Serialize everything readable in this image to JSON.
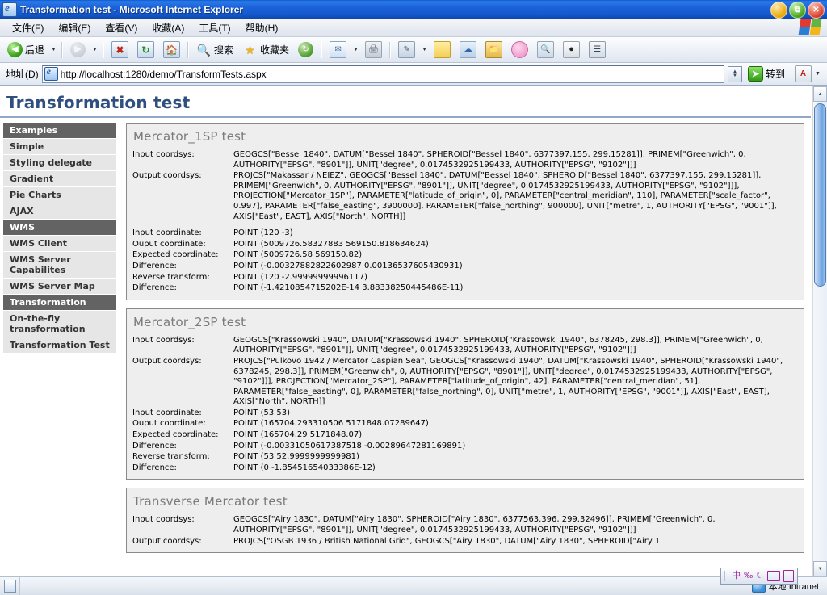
{
  "window": {
    "title": "Transformation test - Microsoft Internet Explorer",
    "minimize_label": "–",
    "restore_label": "❐",
    "close_label": "✕"
  },
  "menu": [
    {
      "label": "文件(F)",
      "name": "menu-file"
    },
    {
      "label": "编辑(E)",
      "name": "menu-edit"
    },
    {
      "label": "查看(V)",
      "name": "menu-view"
    },
    {
      "label": "收藏(A)",
      "name": "menu-favorites"
    },
    {
      "label": "工具(T)",
      "name": "menu-tools"
    },
    {
      "label": "帮助(H)",
      "name": "menu-help"
    }
  ],
  "toolbar": {
    "back_label": "后退",
    "forward_label": "",
    "search_label": "搜索",
    "favorites_label": "收藏夹",
    "dropdown_caret": "▼"
  },
  "address": {
    "label": "地址(D)",
    "url": "http://localhost:1280/demo/TransformTests.aspx",
    "go_label": "转到"
  },
  "page": {
    "title": "Transformation test",
    "sidebar": [
      {
        "label": "Examples",
        "type": "header"
      },
      {
        "label": "Simple",
        "type": "item"
      },
      {
        "label": "Styling delegate",
        "type": "item"
      },
      {
        "label": "Gradient",
        "type": "item"
      },
      {
        "label": "Pie Charts",
        "type": "item"
      },
      {
        "label": "AJAX",
        "type": "item"
      },
      {
        "label": "WMS",
        "type": "header"
      },
      {
        "label": "WMS Client",
        "type": "item"
      },
      {
        "label": "WMS Server Capabilites",
        "type": "item"
      },
      {
        "label": "WMS Server Map",
        "type": "item"
      },
      {
        "label": "Transformation",
        "type": "header"
      },
      {
        "label": "On-the-fly transformation",
        "type": "item"
      },
      {
        "label": "Transformation Test",
        "type": "item"
      }
    ],
    "tests": [
      {
        "title": "Mercator_1SP test",
        "rows": [
          {
            "label": "Input coordsys:",
            "value": "GEOGCS[\"Bessel 1840\", DATUM[\"Bessel 1840\", SPHEROID[\"Bessel 1840\", 6377397.155, 299.15281]], PRIMEM[\"Greenwich\", 0, AUTHORITY[\"EPSG\", \"8901\"]], UNIT[\"degree\", 0.0174532925199433, AUTHORITY[\"EPSG\", \"9102\"]]]"
          },
          {
            "label": "Output coordsys:",
            "value": "PROJCS[\"Makassar / NEIEZ\", GEOGCS[\"Bessel 1840\", DATUM[\"Bessel 1840\", SPHEROID[\"Bessel 1840\", 6377397.155, 299.15281]], PRIMEM[\"Greenwich\", 0, AUTHORITY[\"EPSG\", \"8901\"]], UNIT[\"degree\", 0.0174532925199433, AUTHORITY[\"EPSG\", \"9102\"]]], PROJECTION[\"Mercator_1SP\"], PARAMETER[\"latitude_of_origin\", 0], PARAMETER[\"central_meridian\", 110], PARAMETER[\"scale_factor\", 0.997], PARAMETER[\"false_easting\", 3900000], PARAMETER[\"false_northing\", 900000], UNIT[\"metre\", 1, AUTHORITY[\"EPSG\", \"9001\"]], AXIS[\"East\", EAST], AXIS[\"North\", NORTH]]"
          },
          {
            "label": "Input coordinate:",
            "value": "POINT (120 -3)",
            "gap": true
          },
          {
            "label": "Ouput coordinate:",
            "value": "POINT (5009726.58327883 569150.818634624)"
          },
          {
            "label": "Expected coordinate:",
            "value": "POINT (5009726.58 569150.82)"
          },
          {
            "label": "Difference:",
            "value": "POINT (-0.00327882822602987 0.00136537605430931)"
          },
          {
            "label": "Reverse transform:",
            "value": "POINT (120 -2.99999999996117)"
          },
          {
            "label": "Difference:",
            "value": "POINT (-1.4210854715202E-14 3.88338250445486E-11)"
          }
        ]
      },
      {
        "title": "Mercator_2SP test",
        "rows": [
          {
            "label": "Input coordsys:",
            "value": "GEOGCS[\"Krassowski 1940\", DATUM[\"Krassowski 1940\", SPHEROID[\"Krassowski 1940\", 6378245, 298.3]], PRIMEM[\"Greenwich\", 0, AUTHORITY[\"EPSG\", \"8901\"]], UNIT[\"degree\", 0.0174532925199433, AUTHORITY[\"EPSG\", \"9102\"]]]"
          },
          {
            "label": "Output coordsys:",
            "value": "PROJCS[\"Pulkovo 1942 / Mercator Caspian Sea\", GEOGCS[\"Krassowski 1940\", DATUM[\"Krassowski 1940\", SPHEROID[\"Krassowski 1940\", 6378245, 298.3]], PRIMEM[\"Greenwich\", 0, AUTHORITY[\"EPSG\", \"8901\"]], UNIT[\"degree\", 0.0174532925199433, AUTHORITY[\"EPSG\", \"9102\"]]], PROJECTION[\"Mercator_2SP\"], PARAMETER[\"latitude_of_origin\", 42], PARAMETER[\"central_meridian\", 51], PARAMETER[\"false_easting\", 0], PARAMETER[\"false_northing\", 0], UNIT[\"metre\", 1, AUTHORITY[\"EPSG\", \"9001\"]], AXIS[\"East\", EAST], AXIS[\"North\", NORTH]]"
          },
          {
            "label": "Input coordinate:",
            "value": "POINT (53 53)"
          },
          {
            "label": "Ouput coordinate:",
            "value": "POINT (165704.293310506 5171848.07289647)"
          },
          {
            "label": "Expected coordinate:",
            "value": "POINT (165704.29 5171848.07)"
          },
          {
            "label": "Difference:",
            "value": "POINT (-0.00331050617387518 -0.00289647281169891)"
          },
          {
            "label": "Reverse transform:",
            "value": "POINT (53 52.9999999999981)"
          },
          {
            "label": "Difference:",
            "value": "POINT (0 -1.85451654033386E-12)"
          }
        ]
      },
      {
        "title": "Transverse Mercator test",
        "rows": [
          {
            "label": "Input coordsys:",
            "value": "GEOGCS[\"Airy 1830\", DATUM[\"Airy 1830\", SPHEROID[\"Airy 1830\", 6377563.396, 299.32496]], PRIMEM[\"Greenwich\", 0, AUTHORITY[\"EPSG\", \"8901\"]], UNIT[\"degree\", 0.0174532925199433, AUTHORITY[\"EPSG\", \"9102\"]]]"
          },
          {
            "label": "Output coordsys:",
            "value": "PROJCS[\"OSGB 1936 / British National Grid\", GEOGCS[\"Airy 1830\", DATUM[\"Airy 1830\", SPHEROID[\"Airy 1"
          }
        ]
      }
    ]
  },
  "statusbar": {
    "zone": "本地 Intranet"
  }
}
